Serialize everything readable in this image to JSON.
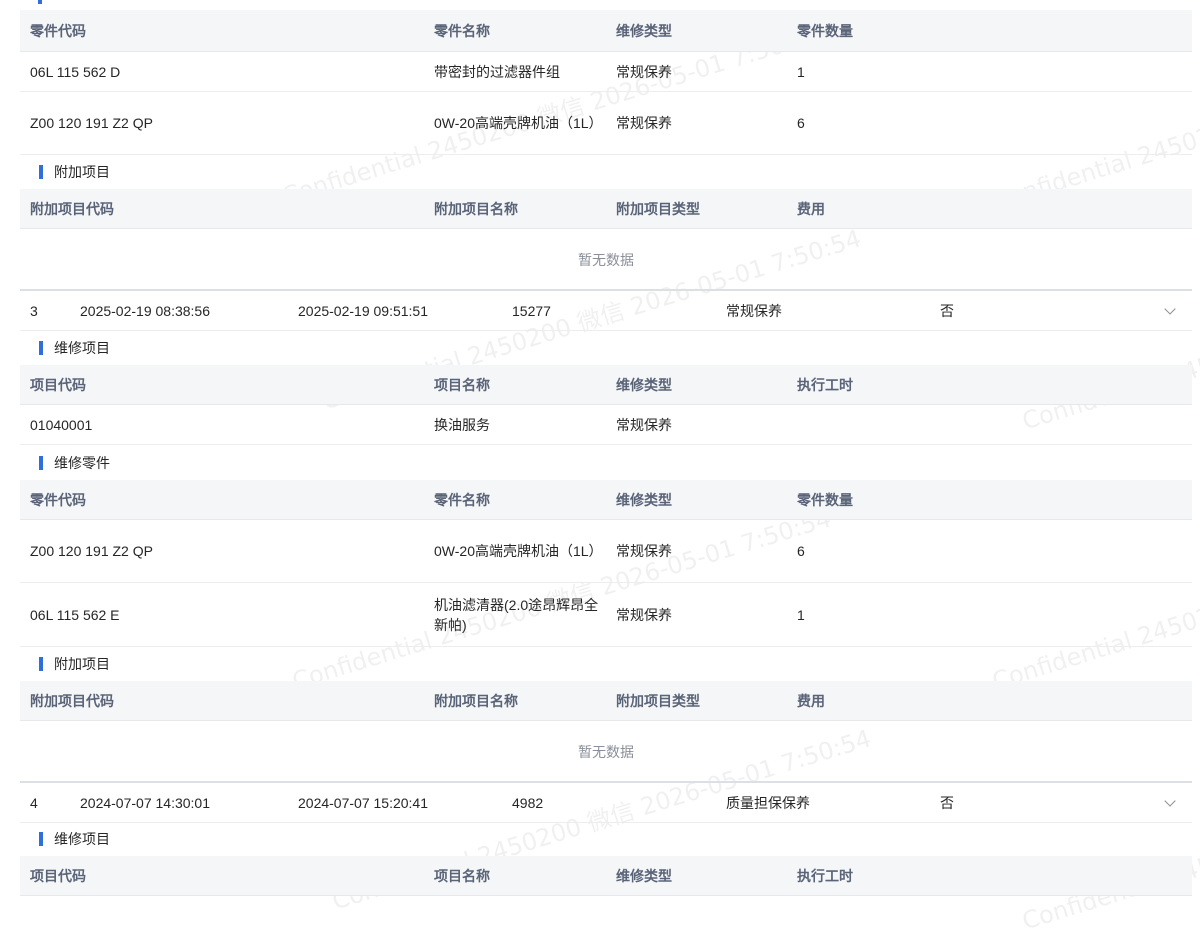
{
  "top_parts_table": {
    "headers": [
      "零件代码",
      "零件名称",
      "维修类型",
      "零件数量"
    ],
    "rows": [
      [
        "06L 115 562 D",
        "带密封的过滤器件组",
        "常规保养",
        "1"
      ],
      [
        "Z00 120 191 Z2 QP",
        "0W-20高端壳牌机油（1L）",
        "常规保养",
        "6"
      ]
    ]
  },
  "sections": {
    "repair_items": "维修项目",
    "repair_parts": "维修零件",
    "additional_items": "附加项目"
  },
  "additional_headers": [
    "附加项目代码",
    "附加项目名称",
    "附加项目类型",
    "费用"
  ],
  "items_headers": [
    "项目代码",
    "项目名称",
    "维修类型",
    "执行工时"
  ],
  "empty_text": "暂无数据",
  "record3": {
    "index": "3",
    "start": "2025-02-19 08:38:56",
    "end": "2025-02-19 09:51:51",
    "mileage": "15277",
    "type": "常规保养",
    "flag": "否",
    "items": [
      [
        "01040001",
        "换油服务",
        "常规保养",
        ""
      ]
    ],
    "parts": [
      [
        "Z00 120 191 Z2 QP",
        "0W-20高端壳牌机油（1L）",
        "常规保养",
        "6"
      ],
      [
        "06L 115 562 E",
        "机油滤清器(2.0途昂辉昂全新帕)",
        "常规保养",
        "1"
      ]
    ]
  },
  "record4": {
    "index": "4",
    "start": "2024-07-07 14:30:01",
    "end": "2024-07-07 15:20:41",
    "mileage": "4982",
    "type": "质量担保保养",
    "flag": "否"
  },
  "watermark": "Confidential 2450200 微信 2026-05-01 7:50:54",
  "colors": {
    "accent": "#2f6fdc",
    "header_bg": "#f5f6f7",
    "header_text": "#5a6478"
  },
  "icons": {
    "expand": "chevron-down-icon",
    "section": "section-marker-icon"
  }
}
